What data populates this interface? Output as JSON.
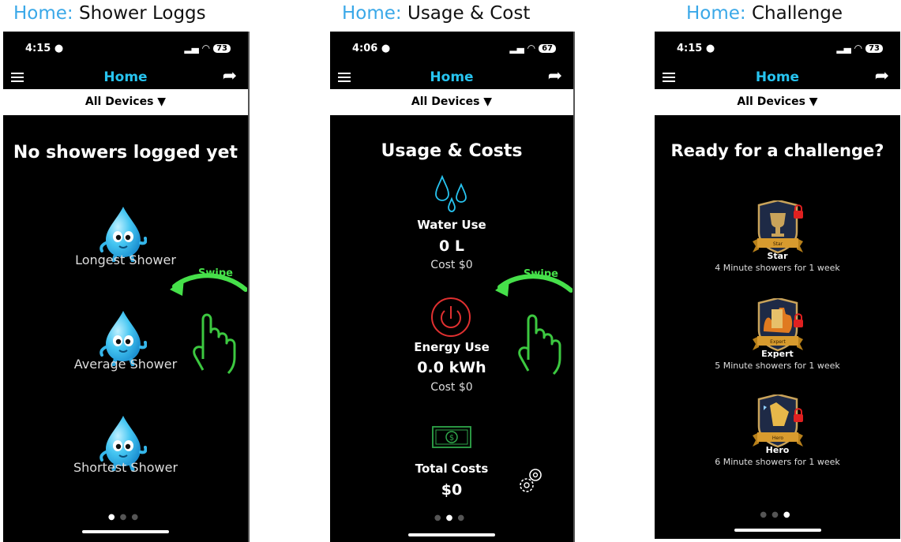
{
  "captions": [
    {
      "prefix": "Home:",
      "text": "Shower Loggs"
    },
    {
      "prefix": "Home:",
      "text": "Usage & Cost"
    },
    {
      "prefix": "Home:",
      "text": "Challenge"
    }
  ],
  "phones": [
    {
      "time": "4:15",
      "battery": "73",
      "header_title": "Home",
      "filter_label": "All Devices",
      "title": "No showers logged yet",
      "labels": [
        "Longest Shower",
        "Average Shower",
        "Shortest Shower"
      ],
      "swipe_label": "Swipe",
      "active_page": 0
    },
    {
      "time": "4:06",
      "battery": "67",
      "header_title": "Home",
      "filter_label": "All Devices",
      "title": "Usage & Costs",
      "water": {
        "title": "Water Use",
        "value": "0 L",
        "cost": "Cost $0"
      },
      "energy": {
        "title": "Energy Use",
        "value": "0.0 kWh",
        "cost": "Cost $0"
      },
      "total": {
        "title": "Total Costs",
        "value": "$0"
      },
      "swipe_label": "Swipe",
      "active_page": 1
    },
    {
      "time": "4:15",
      "battery": "73",
      "header_title": "Home",
      "filter_label": "All Devices",
      "title": "Ready for a challenge?",
      "badges": [
        {
          "name": "Star",
          "desc": "4 Minute showers for 1 week",
          "ribbon": "Star"
        },
        {
          "name": "Expert",
          "desc": "5 Minute showers for 1 week",
          "ribbon": "Expert"
        },
        {
          "name": "Hero",
          "desc": "6 Minute showers for 1 week",
          "ribbon": "Hero"
        }
      ],
      "active_page": 2
    }
  ],
  "colors": {
    "accent": "#27c4f0",
    "swipe": "#46e04a",
    "energy": "#e03030",
    "money": "#2fa64a",
    "caption_prefix": "#3aa8e8"
  },
  "icons": [
    "menu-icon",
    "share-icon",
    "filter-icon",
    "water-drop-mascot",
    "water-drops-icon",
    "power-icon",
    "money-icon",
    "settings-gear-icon",
    "swipe-hand-icon",
    "trophy-badge",
    "glove-badge",
    "hero-badge",
    "lock-icon"
  ]
}
